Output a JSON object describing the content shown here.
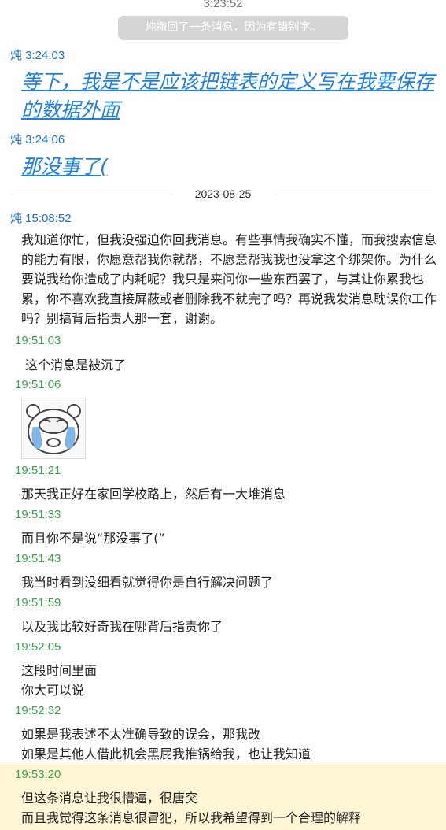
{
  "header": {
    "time": "3:23:52",
    "recall_notice": "炖撤回了一条消息，因为有错别字。"
  },
  "messages_early": [
    {
      "sender": "炖 3:24:03",
      "text": "等下，我是不是应该把链表的定义写在我要保存的数据外面"
    },
    {
      "sender": "炖 3:24:06",
      "text": "那没事了("
    }
  ],
  "divider": {
    "date": "2023-08-25"
  },
  "long_message": {
    "sender": "炖 15:08:52",
    "text": "我知道你忙，但我没强迫你回我消息。有些事情我确实不懂，而我搜索信息的能力有限，你愿意帮我你就帮，不愿意帮我我也没拿这个绑架你。为什么要说我给你造成了内耗呢？我只是来问你一些东西罢了，与其让你累我也累，你不喜欢我直接屏蔽或者删除我不就完了吗？再说我发消息耽误你工作吗？别搞背后指责人那一套，谢谢。"
  },
  "replies": [
    {
      "time": "19:51:03",
      "lines": [
        " 这个消息是被沉了"
      ]
    },
    {
      "time": "19:51:06",
      "sticker": "crying-bear-sticker"
    },
    {
      "time": "19:51:21",
      "lines": [
        "那天我正好在家回学校路上，然后有一大堆消息"
      ]
    },
    {
      "time": "19:51:33",
      "lines": [
        "而且你不是说“那没事了(”"
      ]
    },
    {
      "time": "19:51:43",
      "lines": [
        "我当时看到没细看就觉得你是自行解决问题了"
      ]
    },
    {
      "time": "19:51:59",
      "lines": [
        "以及我比较好奇我在哪背后指责你了"
      ]
    },
    {
      "time": "19:52:05",
      "lines": [
        "这段时间里面",
        "你大可以说"
      ]
    },
    {
      "time": "19:52:32",
      "lines": [
        "如果是我表述不太准确导致的误会，那我改",
        "如果是其他人借此机会黑屁我推锅给我，也让我知道"
      ]
    },
    {
      "time": "19:53:20",
      "lines": [
        "但这条消息让我很懵逼，很唐突",
        "而且我觉得这条消息很冒犯，所以我希望得到一个合理的解释"
      ]
    }
  ],
  "colors": {
    "sender_blue": "#1e6fcf",
    "timestamp_green": "#3aa34f",
    "link_blue": "#1e7fe6",
    "highlight_bg": "#fff6d5"
  }
}
